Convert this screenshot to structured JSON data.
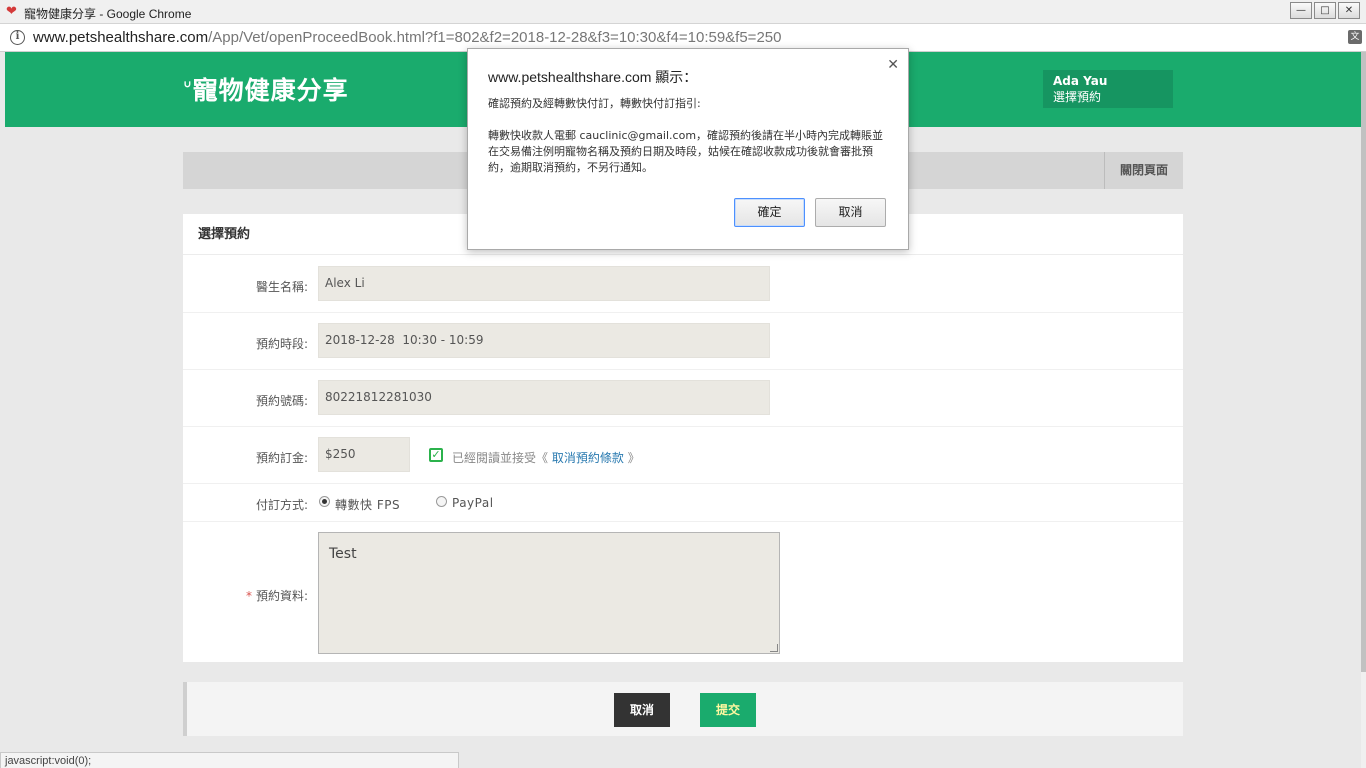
{
  "window": {
    "title": "寵物健康分享 - Google Chrome",
    "controls": {
      "minimize": "—",
      "maximize": "□",
      "close": "✕"
    }
  },
  "address_bar": {
    "url_host": "www.petshealthshare.com",
    "url_path": "/App/Vet/openProceedBook.html?f1=802&f2=2018-12-28&f3=10:30&f4=10:59&f5=250"
  },
  "header": {
    "logo_text": "寵物健康分享",
    "user_name": "Ada Yau",
    "user_sub": "選擇預約"
  },
  "subbar": {
    "close_page_label": "關閉頁面"
  },
  "form": {
    "title": "選擇預約",
    "doctor_label": "醫生名稱:",
    "doctor_value": "Alex Li",
    "time_label": "預約時段:",
    "time_value": "2018-12-28  10:30 - 10:59",
    "number_label": "預約號碼:",
    "number_value": "80221812281030",
    "deposit_label": "預約訂金:",
    "deposit_value": "$250",
    "terms_prefix": "已經閱讀並接受《",
    "terms_link": "取消預約條款",
    "terms_suffix": "》",
    "terms_checked": true,
    "payment_label": "付訂方式:",
    "payment_options": [
      {
        "label": "轉數快 FPS",
        "selected": true
      },
      {
        "label": "PayPal",
        "selected": false
      }
    ],
    "info_required_mark": "*",
    "info_label": "預約資料:",
    "info_value": "Test"
  },
  "footer": {
    "cancel_label": "取消",
    "submit_label": "提交"
  },
  "status_bar": {
    "text": "javascript:void(0);"
  },
  "dialog": {
    "title": "www.petshealthshare.com 顯示：",
    "line1": "確認預約及經轉數快付訂，轉數快付訂指引:",
    "line2": "轉數快收款人電郵 cauclinic@gmail.com，確認預約後請在半小時內完成轉賬並在交易備注例明寵物名稱及預約日期及時段，姑候在確認收款成功後就會審批預約，逾期取消預約，不另行通知。",
    "ok_label": "確定",
    "cancel_label": "取消"
  },
  "colors": {
    "brand_green": "#1aab6d",
    "user_box": "#169561",
    "dark_button": "#333333",
    "link": "#2a7ab0",
    "check": "#2bb24c"
  }
}
